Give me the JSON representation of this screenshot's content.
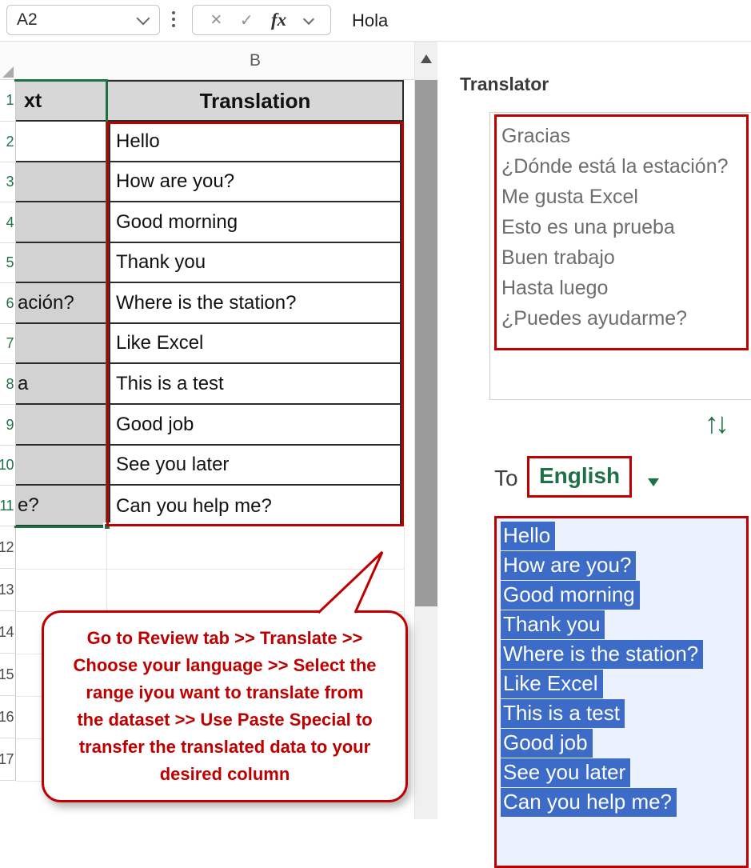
{
  "formula_bar": {
    "name_box_value": "A2",
    "cancel_icon": "×",
    "enter_icon": "✓",
    "fx_label": "fx",
    "value": "Hola"
  },
  "grid": {
    "column_header": "B",
    "row_numbers": [
      "1",
      "2",
      "3",
      "4",
      "5",
      "6",
      "7",
      "8",
      "9",
      "10",
      "11",
      "12",
      "13",
      "14",
      "15",
      "16",
      "17"
    ],
    "a_header_fragment": "xt",
    "b_header": "Translation",
    "a_fragments": {
      "r6": "ación?",
      "r8": "a",
      "r11": "e?"
    },
    "b_values": [
      "Hello",
      "How are you?",
      "Good morning",
      "Thank you",
      "Where is the station?",
      "Like Excel",
      "This is a test",
      "Good job",
      "See you later",
      "Can you help me?"
    ]
  },
  "callout": {
    "lines": [
      "Go to Review tab >> Translate >>",
      "Choose your language >> Select the",
      "range iyou want to translate from",
      "the dataset >> Use Paste Special to",
      "transfer the translated data to your",
      "desired column"
    ]
  },
  "translator": {
    "title": "Translator",
    "source_lines": [
      "Gracias",
      "¿Dónde está la estación?",
      "Me gusta Excel",
      "Esto es una prueba",
      "Buen trabajo",
      "Hasta luego",
      "¿Puedes ayudarme?"
    ],
    "swap_icon": "↑↓",
    "to_label": "To",
    "language_value": "English",
    "result_lines": [
      "Hello",
      "How are you?",
      "Good morning",
      "Thank you",
      "Where is the station?",
      "Like Excel",
      "This is a test",
      "Good job",
      "See you later",
      "Can you help me?"
    ]
  },
  "colors": {
    "annotation_red": "#C00000",
    "excel_green": "#1E7145",
    "selection_blue": "#3D6CC8"
  }
}
